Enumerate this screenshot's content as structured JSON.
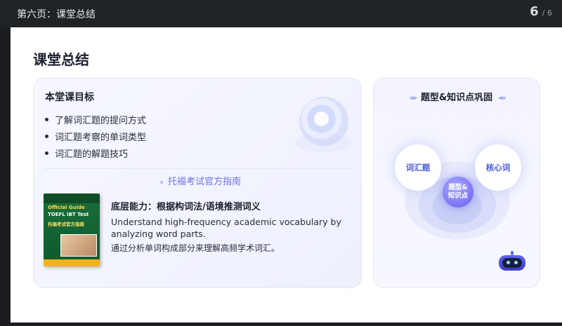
{
  "header": {
    "title": "第六页：课堂总结",
    "page_current": "6",
    "page_total": "/ 6"
  },
  "slide": {
    "title": "课堂总结",
    "goals": {
      "heading": "本堂课目标",
      "items": [
        "了解词汇题的提问方式",
        "词汇题考察的单词类型",
        "词汇题的解题技巧"
      ]
    },
    "guide": {
      "title": "托福考试官方指南",
      "book": {
        "line1": "Official Guide",
        "line2": "TOEFL iBT Test",
        "line3": "托福考试官方指南"
      },
      "ability_heading": "底层能力：根据构词法/语境推测词义",
      "ability_en": "Understand high-frequency academic vocabulary by analyzing word parts.",
      "ability_cn": "通过分析单词构成部分来理解高频学术词汇。"
    },
    "review": {
      "title": "题型&知识点巩固",
      "bubbles": {
        "left": "词汇题",
        "right": "核心词",
        "center": "题型&\n知识点"
      }
    }
  },
  "colors": {
    "accent": "#6a72e6",
    "header_bg": "#202326",
    "card_bg": "#f4f5ff"
  },
  "icons": [
    "robot-icon",
    "chevron-icon",
    "decorative-disk-icon"
  ]
}
